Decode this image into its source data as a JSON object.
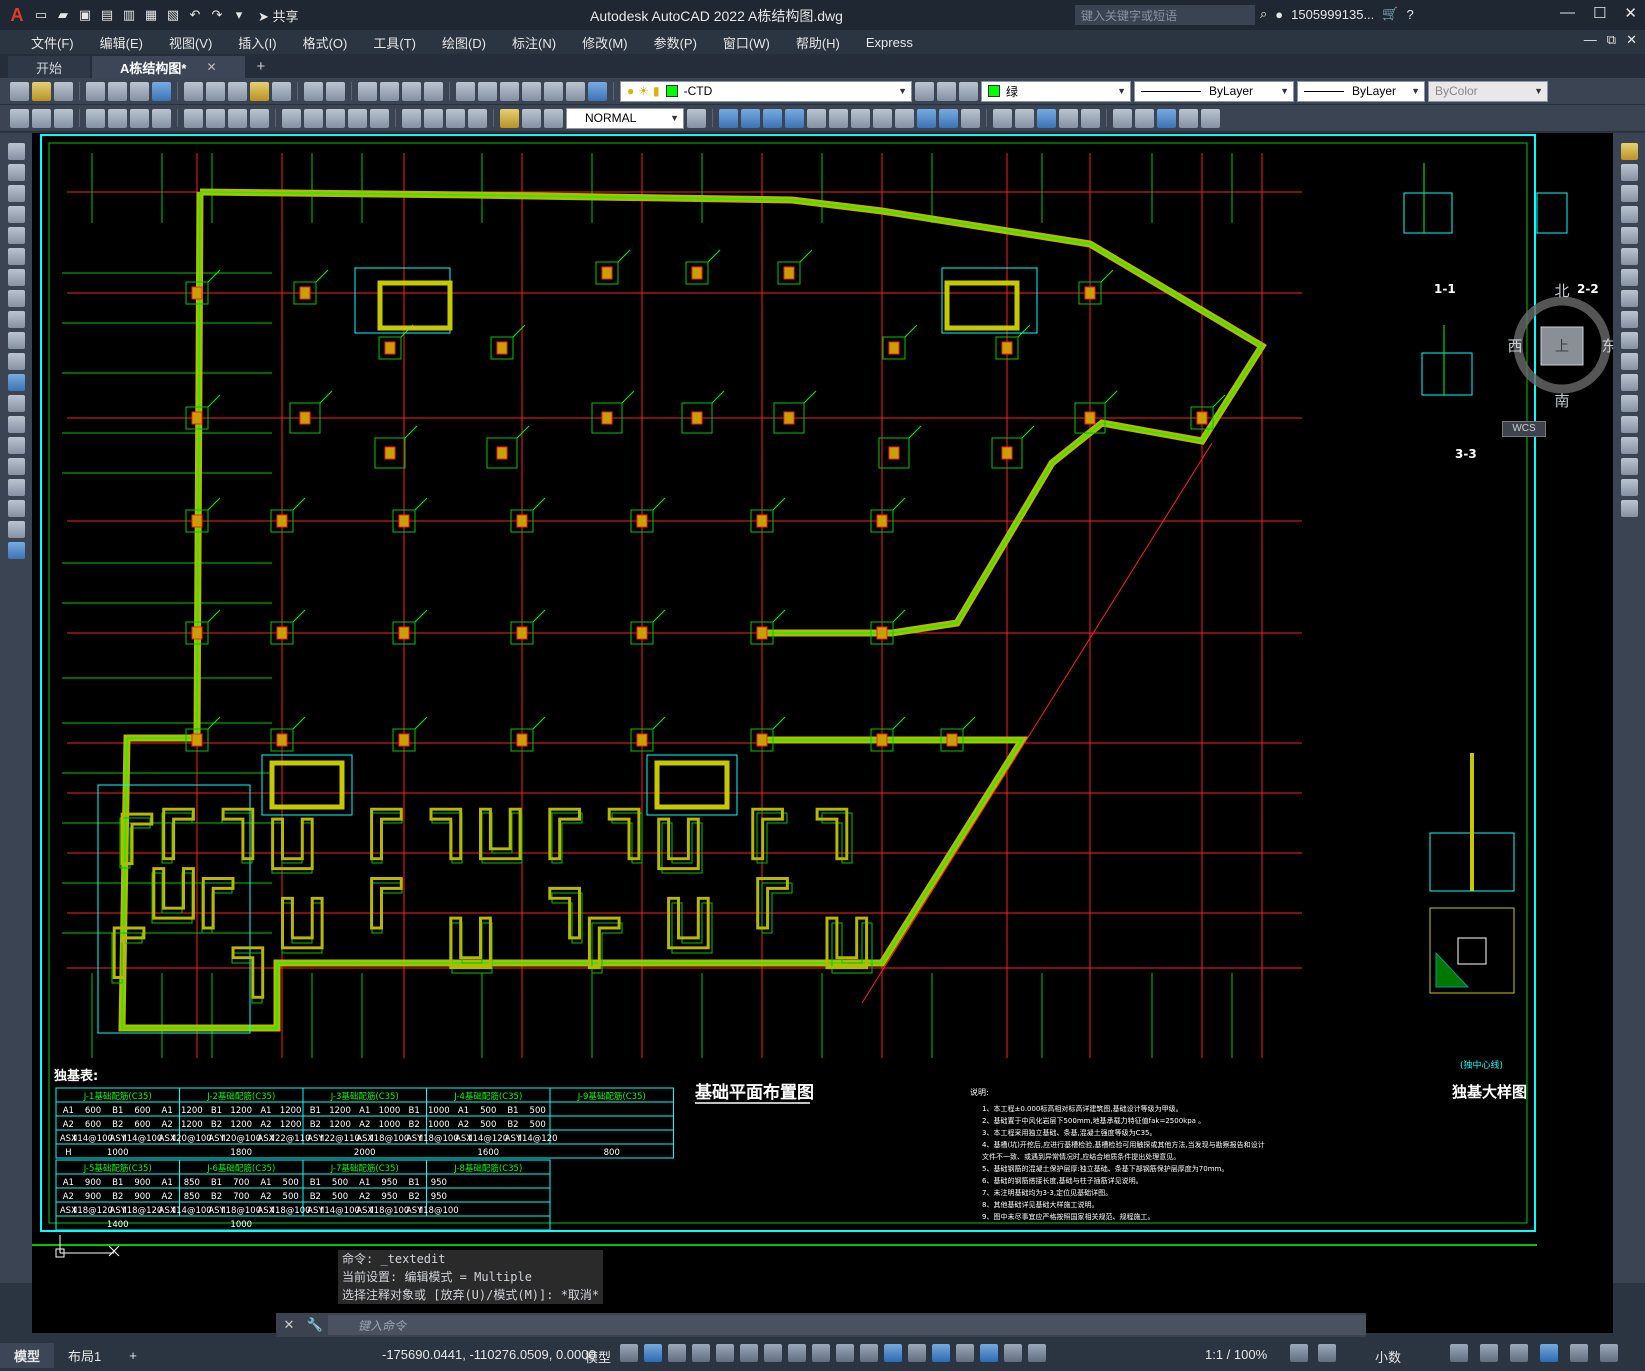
{
  "titlebar": {
    "title": "Autodesk AutoCAD 2022    A栋结构图.dwg",
    "share": "共享",
    "search_placeholder": "键入关键字或短语",
    "user": "1505999135...",
    "minimize": "—",
    "maximize": "☐",
    "close": "✕"
  },
  "menu": {
    "items": [
      "文件(F)",
      "编辑(E)",
      "视图(V)",
      "插入(I)",
      "格式(O)",
      "工具(T)",
      "绘图(D)",
      "标注(N)",
      "修改(M)",
      "参数(P)",
      "窗口(W)",
      "帮助(H)",
      "Express"
    ]
  },
  "tabs": {
    "start": "开始",
    "active": "A栋结构图*",
    "close": "✕",
    "add": "+"
  },
  "toolbar": {
    "layer": "-CTD",
    "color": "绿",
    "linetype": "ByLayer",
    "lineweight": "ByLayer",
    "plotstyle": "ByColor",
    "dimstyle": "NORMAL"
  },
  "viewcube": {
    "north": "北",
    "south": "南",
    "east": "东",
    "west": "西",
    "top": "上",
    "wcs": "WCS"
  },
  "drawing": {
    "main_title": "基础平面布置图",
    "table_title": "独基表:",
    "detail_title": "独基大样图",
    "section_1": "1-1",
    "section_2": "2-2",
    "section_3": "3-3",
    "detail_note": "(独中心线)",
    "notes_title": "说明:",
    "notes": [
      "1、本工程±0.000标高相对标高详建筑图,基础设计等级为甲级。",
      "2、基础置于中风化岩层下500mm,地基承载力特征值fak=2500kpa 。",
      "3、本工程采用独立基础、条基,混凝土强度等级为C35。",
      "4、基槽(坑)开挖后,应进行基槽检验,基槽检验可用触探或其他方法,当发现与勘察报告和设计",
      "   文件不一致、或遇到异常情况时,应结合地质条件提出处理意见。",
      "5、基础钢筋的混凝土保护层厚:独立基础、条基下部钢筋保护层厚度为70mm。",
      "6、基础的钢筋搭接长度,基础与柱子插筋详见说明。",
      "7、未注明基础均为3-3,定位见基础详图。",
      "8、其他基础详见基础大样施工说明。",
      "9、图中未尽事宜应严格按照国家相关规范、规程施工。"
    ],
    "labels": {
      "j1": "J-1",
      "j2": "J-2",
      "j3": "J-3",
      "j4": "J-4",
      "j5": "J-5",
      "j6": "J-6",
      "j7": "J-7",
      "j8": "J-8",
      "j9": "J-9"
    }
  },
  "foundation_table": {
    "row1_headers": [
      "J-1基础配筋(C35)",
      "J-2基础配筋(C35)",
      "J-3基础配筋(C35)",
      "J-4基础配筋(C35)",
      "J-9基础配筋(C35)"
    ],
    "row1_rows": [
      [
        "A1",
        "600",
        "B1",
        "600",
        "A1",
        "1200",
        "B1",
        "1200",
        "A1",
        "1200",
        "B1",
        "1200",
        "A1",
        "1000",
        "B1",
        "1000",
        "A1",
        "500",
        "B1",
        "500"
      ],
      [
        "A2",
        "600",
        "B2",
        "600",
        "A2",
        "1200",
        "B2",
        "1200",
        "A2",
        "1200",
        "B2",
        "1200",
        "A2",
        "1000",
        "B2",
        "1000",
        "A2",
        "500",
        "B2",
        "500"
      ],
      [
        "ASX",
        "Ⅱ14@100",
        "ASY",
        "Ⅱ14@100",
        "ASX",
        "Ⅱ20@100",
        "ASY",
        "Ⅱ20@100",
        "ASX",
        "Ⅱ22@110",
        "ASY",
        "Ⅱ22@110",
        "ASX",
        "Ⅱ18@100",
        "ASY",
        "Ⅱ18@100",
        "ASX",
        "Ⅱ14@120",
        "ASY",
        "Ⅱ14@120"
      ]
    ],
    "row1_h": [
      "H",
      "1000",
      "1800",
      "2000",
      "1600",
      "800"
    ],
    "row2_headers": [
      "J-5基础配筋(C35)",
      "J-6基础配筋(C35)",
      "J-7基础配筋(C35)",
      "J-8基础配筋(C35)"
    ],
    "row2_rows": [
      [
        "A1",
        "900",
        "B1",
        "900",
        "A1",
        "850",
        "B1",
        "700",
        "A1",
        "500",
        "B1",
        "500",
        "A1",
        "950",
        "B1",
        "950"
      ],
      [
        "A2",
        "900",
        "B2",
        "900",
        "A2",
        "850",
        "B2",
        "700",
        "A2",
        "500",
        "B2",
        "500",
        "A2",
        "950",
        "B2",
        "950"
      ],
      [
        "ASX",
        "Ⅱ18@120",
        "ASY",
        "Ⅱ18@120",
        "ASX",
        "Ⅱ14@100",
        "ASY",
        "Ⅱ18@100",
        "ASX",
        "Ⅱ18@100",
        "ASY",
        "Ⅱ14@100",
        "ASX",
        "Ⅱ18@100",
        "ASY",
        "Ⅱ18@100"
      ]
    ],
    "row2_h": [
      "1400",
      "1000"
    ]
  },
  "command": {
    "history_1": "命令: _textedit",
    "history_2": "当前设置: 编辑模式 = Multiple",
    "history_3": "选择注释对象或 [放弃(U)/模式(M)]: *取消*",
    "placeholder": "键入命令"
  },
  "status": {
    "model_tab": "模型",
    "layout_tab": "布局1",
    "add": "+",
    "coords": "-175690.0441, -110276.0509, 0.0000",
    "model": "模型",
    "scale": "1:1 / 100%",
    "units": "小数"
  },
  "colors": {
    "canvas": "#000000",
    "grid_red": "#ff2020",
    "grid_green": "#00c800",
    "wall_yellow": "#c8c800",
    "cyan": "#00ffff"
  }
}
